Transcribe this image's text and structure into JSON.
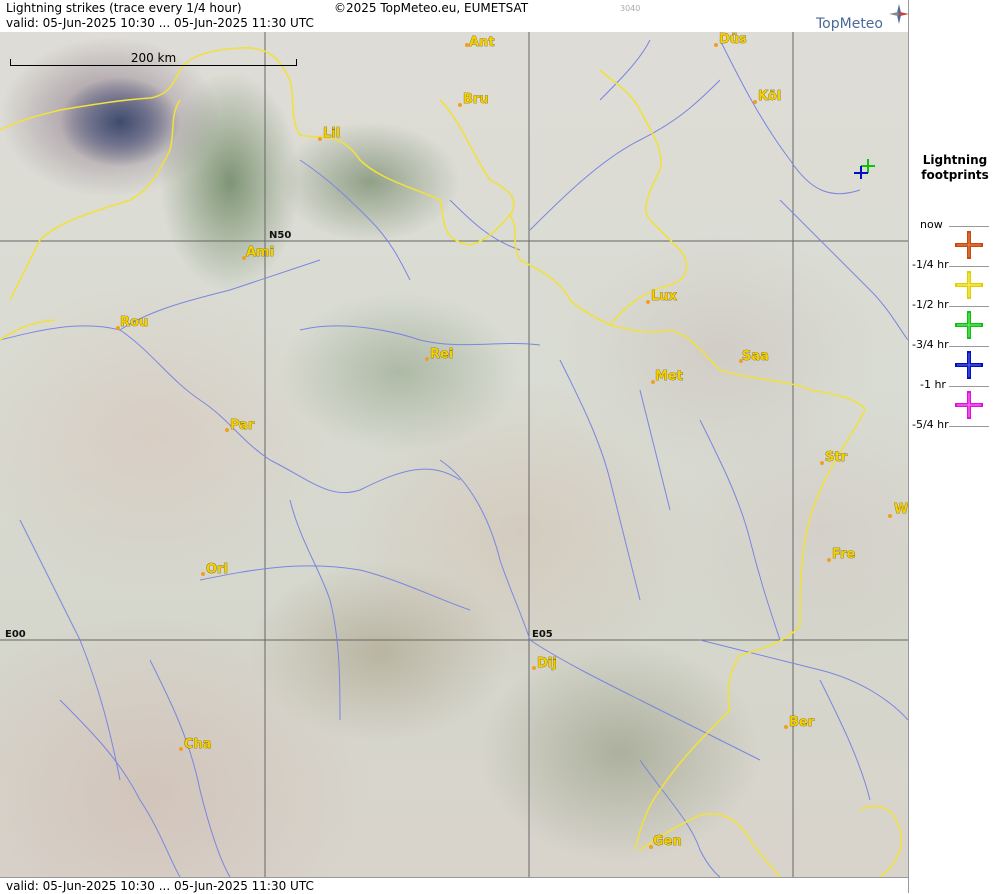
{
  "header": {
    "title": "Lightning strikes (trace every 1/4 hour)",
    "copyright": "©2025 TopMeteo.eu, EUMETSAT",
    "product_code": "3040",
    "valid": "valid:  05-Jun-2025 10:30 ... 05-Jun-2025 11:30 UTC"
  },
  "footer": {
    "valid": "valid:  05-Jun-2025 10:30 ... 05-Jun-2025 11:30 UTC"
  },
  "logo": {
    "text": "TopMeteo"
  },
  "scale": {
    "label": "200 km"
  },
  "grid_labels": {
    "lat": "N50",
    "lon_west": "E00",
    "lon_east": "E05"
  },
  "cities": [
    {
      "name": "Ant"
    },
    {
      "name": "Düs"
    },
    {
      "name": "Köl"
    },
    {
      "name": "Bru"
    },
    {
      "name": "Lil"
    },
    {
      "name": "Ami"
    },
    {
      "name": "Rou"
    },
    {
      "name": "Lux"
    },
    {
      "name": "Rei"
    },
    {
      "name": "Saa"
    },
    {
      "name": "Met"
    },
    {
      "name": "Par"
    },
    {
      "name": "Str"
    },
    {
      "name": "W"
    },
    {
      "name": "Fre"
    },
    {
      "name": "Orl"
    },
    {
      "name": "Dij"
    },
    {
      "name": "Ber"
    },
    {
      "name": "Cha"
    },
    {
      "name": "Gen"
    }
  ],
  "legend": {
    "title_line1": "Lightning",
    "title_line2": "footprints",
    "entries": [
      {
        "label": "now",
        "color": "#c84a10"
      },
      {
        "label": "-1/4 hr",
        "color": "#e0d000"
      },
      {
        "label": "-1/2 hr",
        "color": "#10c010"
      },
      {
        "label": "-3/4 hr",
        "color": "#0010c0"
      },
      {
        "label": "-1 hr",
        "color": "#e010e0"
      },
      {
        "label": "-5/4 hr",
        "color": ""
      }
    ]
  },
  "colors": {
    "border": "#f0e040",
    "river": "#7a86e0",
    "grid": "#666666"
  }
}
